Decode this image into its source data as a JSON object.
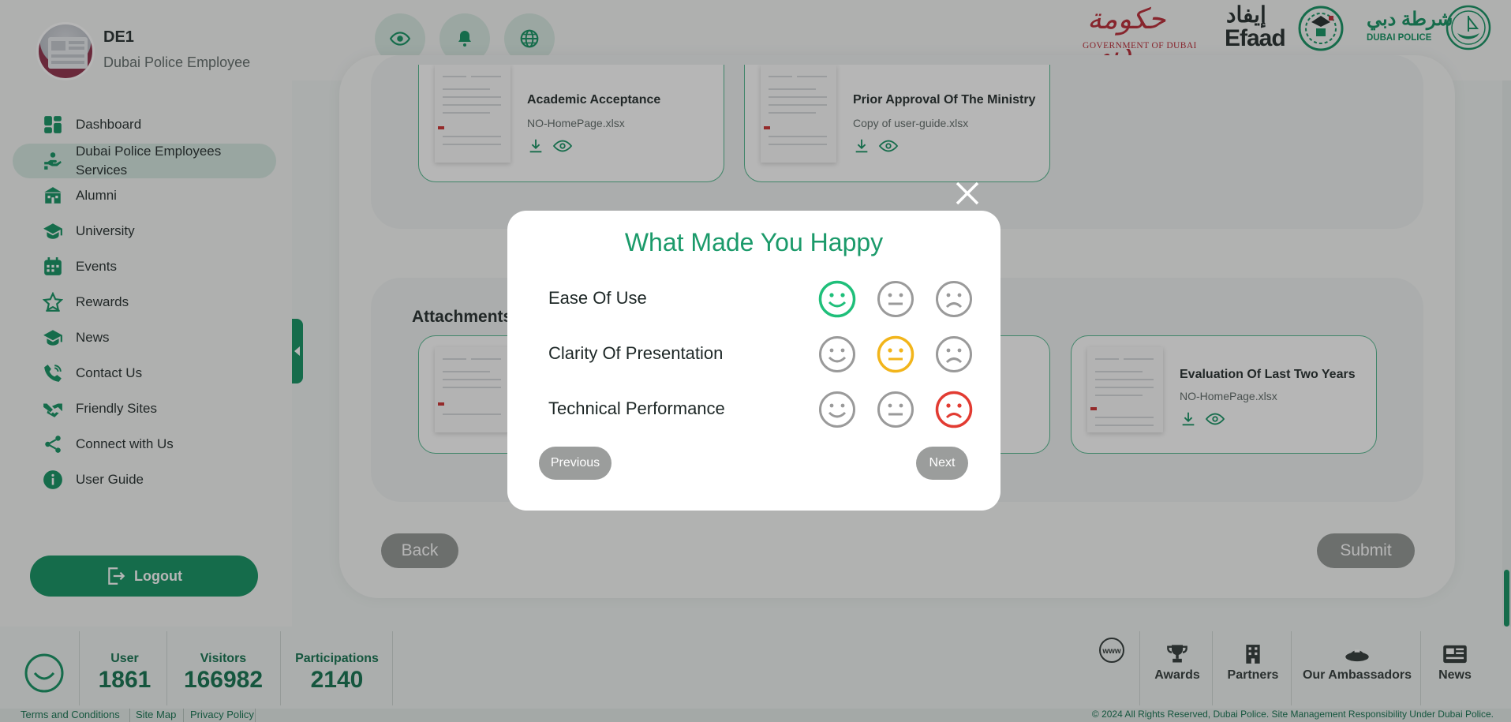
{
  "header": {
    "user_name": "DE1",
    "user_role": "Dubai Police Employee",
    "icons": [
      "eye-icon",
      "bell-icon",
      "globe-icon"
    ],
    "logos": {
      "gov_dubai_arabic": "حكومة دبي",
      "gov_dubai_text": "GOVERNMENT OF DUBAI",
      "efaad_arabic": "إيفاد",
      "efaad_text": "Efaad",
      "police_arabic": "شرطة دبي",
      "police_text": "DUBAI POLICE"
    }
  },
  "sidebar": {
    "items": [
      {
        "label": "Dashboard",
        "icon": "dashboard-icon"
      },
      {
        "label": "Dubai Police Employees Services",
        "icon": "hand-services-icon"
      },
      {
        "label": "Alumni",
        "icon": "building-icon"
      },
      {
        "label": "University",
        "icon": "graduation-cap-icon"
      },
      {
        "label": "Events",
        "icon": "calendar-icon"
      },
      {
        "label": "Rewards",
        "icon": "star-icon"
      },
      {
        "label": "News",
        "icon": "news-cap-icon"
      },
      {
        "label": "Contact Us",
        "icon": "phone-icon"
      },
      {
        "label": "Friendly Sites",
        "icon": "handshake-icon"
      },
      {
        "label": "Connect with Us",
        "icon": "share-icon"
      },
      {
        "label": "User Guide",
        "icon": "info-icon"
      }
    ],
    "active_index": 1,
    "logout_label": "Logout"
  },
  "main": {
    "top_cards": [
      {
        "title": "Academic Acceptance",
        "file": "NO-HomePage.xlsx"
      },
      {
        "title": "Prior Approval Of The Ministry",
        "file": "Copy of user-guide.xlsx"
      }
    ],
    "attachments_title": "Attachments",
    "attachment_cards": [
      {
        "title": "",
        "file": ""
      },
      {
        "title": "",
        "file": ""
      },
      {
        "title": "Evaluation Of Last Two Years",
        "file": "NO-HomePage.xlsx"
      }
    ],
    "back_label": "Back",
    "submit_label": "Submit"
  },
  "modal": {
    "title": "What Made You Happy",
    "rows": [
      {
        "label": "Ease Of Use",
        "selected": "happy"
      },
      {
        "label": "Clarity Of Presentation",
        "selected": "neutral"
      },
      {
        "label": "Technical Performance",
        "selected": "sad"
      }
    ],
    "previous_label": "Previous",
    "next_label": "Next",
    "colors": {
      "happy": "#1fbf7a",
      "neutral": "#f2b51b",
      "sad": "#e23b32",
      "unselected": "#9a9a9a"
    }
  },
  "footer": {
    "stats": [
      {
        "label": "User",
        "value": "1861"
      },
      {
        "label": "Visitors",
        "value": "166982"
      },
      {
        "label": "Participations",
        "value": "2140"
      }
    ],
    "links": [
      {
        "label": "",
        "icon": "www-icon",
        "badge": "www"
      },
      {
        "label": "Awards",
        "icon": "trophy-icon"
      },
      {
        "label": "Partners",
        "icon": "office-building-icon"
      },
      {
        "label": "Our Ambassadors",
        "icon": "ambassador-cap-icon"
      },
      {
        "label": "News",
        "icon": "newspaper-icon"
      }
    ],
    "legal_links": [
      "Terms and Conditions",
      "Site Map",
      "Privacy Policy"
    ],
    "copyright": "© 2024 All Rights Reserved, Dubai Police. Site Management Responsibility Under Dubai Police."
  },
  "colors": {
    "brand_green": "#0c8f5d",
    "accent_light": "#d3e7df",
    "title_green": "#1b9a6a"
  }
}
